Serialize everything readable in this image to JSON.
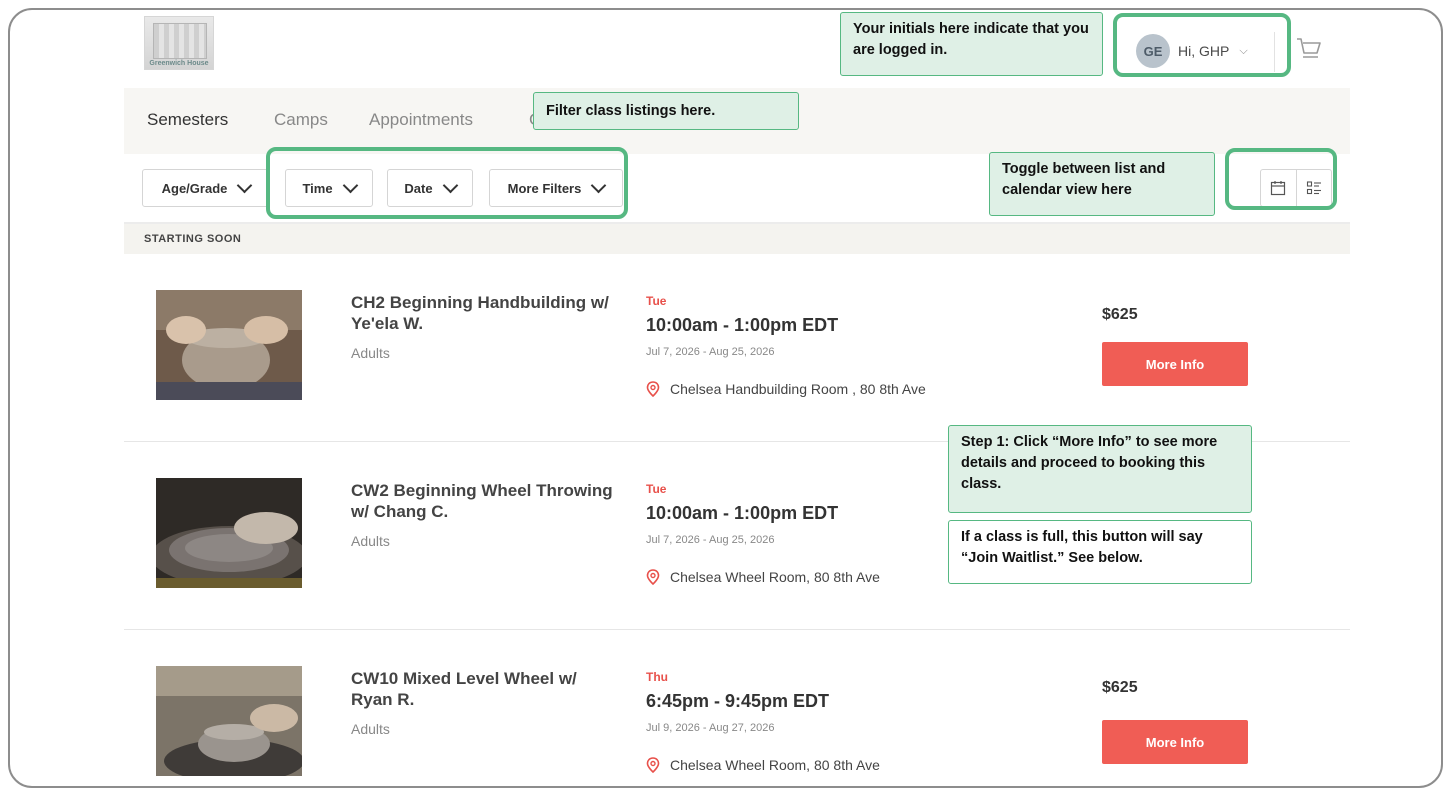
{
  "header": {
    "logo_text": "Greenwich House",
    "user_initials": "GE",
    "greeting": "Hi, GHP",
    "caret": "⌵"
  },
  "nav": {
    "tabs": [
      {
        "label": "Semesters",
        "active": true
      },
      {
        "label": "Camps",
        "active": false
      },
      {
        "label": "Appointments",
        "active": false
      },
      {
        "label": "G",
        "active": false
      }
    ]
  },
  "filters": {
    "age_grade": "Age/Grade",
    "time": "Time",
    "date": "Date",
    "more_filters": "More Filters"
  },
  "section": {
    "title": "STARTING SOON"
  },
  "listings": [
    {
      "name": "CH2 Beginning Handbuilding w/ Ye'ela W.",
      "audience": "Adults",
      "day": "Tue",
      "time": "10:00am - 1:00pm EDT",
      "dates": "Jul 7, 2026 - Aug 25, 2026",
      "location": "Chelsea Handbuilding Room , 80 8th Ave",
      "price": "$625",
      "button": "More Info"
    },
    {
      "name": "CW2 Beginning Wheel Throwing w/ Chang C.",
      "audience": "Adults",
      "day": "Tue",
      "time": "10:00am - 1:00pm EDT",
      "dates": "Jul 7, 2026 - Aug 25, 2026",
      "location": "Chelsea Wheel Room, 80 8th Ave"
    },
    {
      "name": "CW10 Mixed Level Wheel w/ Ryan R.",
      "audience": "Adults",
      "day": "Thu",
      "time": "6:45pm - 9:45pm EDT",
      "dates": "Jul 9, 2026 - Aug 27, 2026",
      "location": "Chelsea Wheel Room, 80 8th Ave",
      "price": "$625",
      "button": "More Info"
    }
  ],
  "callouts": {
    "logged_in": "Your initials here indicate that you are logged in.",
    "filter": "Filter class listings here.",
    "toggle": "Toggle between list and calendar view here",
    "step1": "Step 1: Click “More Info” to see more details and proceed to booking this class.",
    "waitlist": "If a class is full, this button will say “Join Waitlist.” See below."
  },
  "colors": {
    "accent_button": "#f05d55",
    "day_label": "#e8514b",
    "callout_border": "#56b882",
    "callout_fill": "#dff0e6"
  },
  "icons": {
    "cart": "cart-icon",
    "calendar_view": "calendar-icon",
    "list_view": "list-view-icon",
    "location": "location-pin-icon",
    "dropdown": "chevron-down-icon"
  }
}
